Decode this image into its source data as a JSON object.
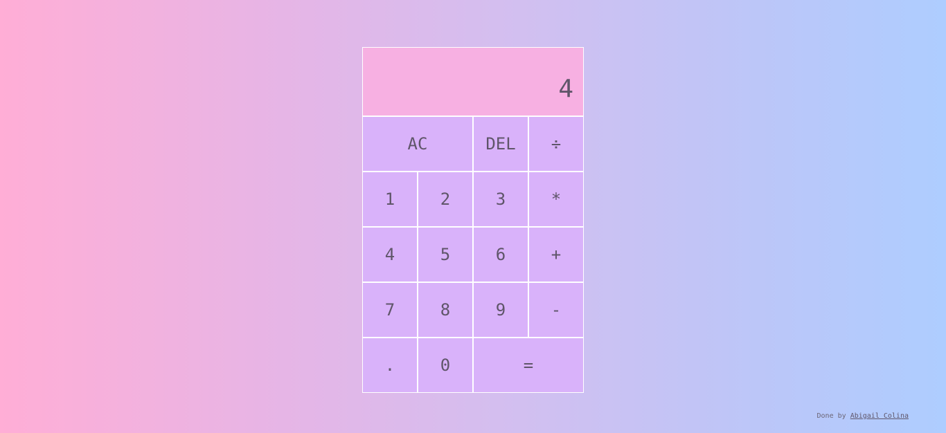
{
  "display": {
    "value": "4"
  },
  "keys": {
    "ac": "AC",
    "del": "DEL",
    "divide": "÷",
    "one": "1",
    "two": "2",
    "three": "3",
    "multiply": "*",
    "four": "4",
    "five": "5",
    "six": "6",
    "plus": "+",
    "seven": "7",
    "eight": "8",
    "nine": "9",
    "minus": "-",
    "dot": ".",
    "zero": "0",
    "equals": "="
  },
  "footer": {
    "prefix": "Done by",
    "author": "Abigail Colina"
  }
}
